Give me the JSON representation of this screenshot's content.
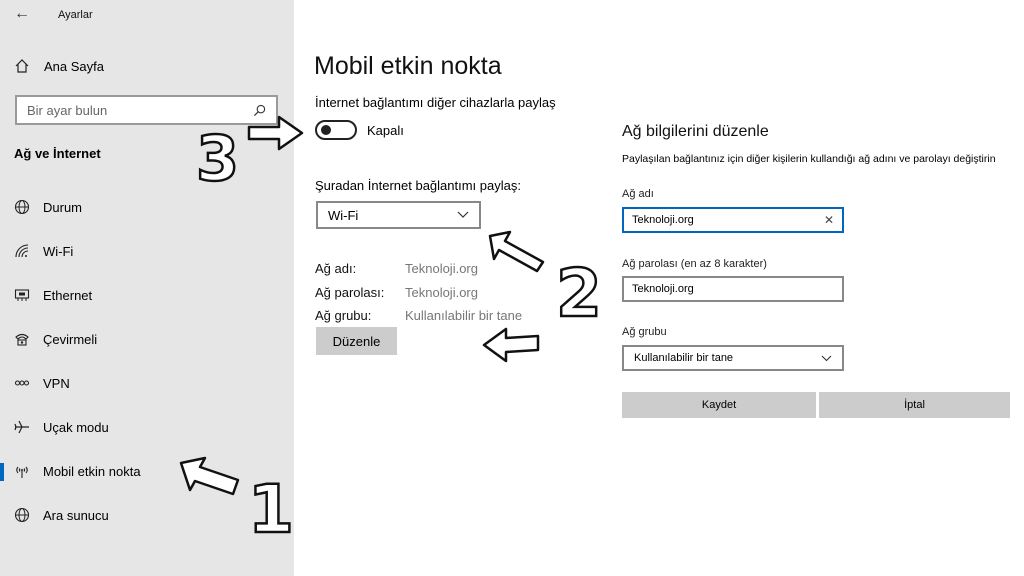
{
  "titlebar": {
    "back_icon": "back-arrow-icon",
    "title": "Ayarlar"
  },
  "sidebar": {
    "home_label": "Ana Sayfa",
    "search_placeholder": "Bir ayar bulun",
    "section_title": "Ağ ve İnternet",
    "items": [
      {
        "label": "Durum",
        "icon": "globe-icon"
      },
      {
        "label": "Wi-Fi",
        "icon": "wifi-icon"
      },
      {
        "label": "Ethernet",
        "icon": "ethernet-icon"
      },
      {
        "label": "Çevirmeli",
        "icon": "dialup-icon"
      },
      {
        "label": "VPN",
        "icon": "vpn-icon"
      },
      {
        "label": "Uçak modu",
        "icon": "airplane-icon"
      },
      {
        "label": "Mobil etkin nokta",
        "icon": "hotspot-icon",
        "active": true
      },
      {
        "label": "Ara sunucu",
        "icon": "globe-icon"
      }
    ]
  },
  "main": {
    "title": "Mobil etkin nokta",
    "share_label": "İnternet bağlantımı diğer cihazlarla paylaş",
    "toggle_state": "Kapalı",
    "from_label": "Şuradan İnternet bağlantımı paylaş:",
    "from_value": "Wi-Fi",
    "info": [
      {
        "key": "Ağ adı:",
        "value": "Teknoloji.org"
      },
      {
        "key": "Ağ parolası:",
        "value": "Teknoloji.org"
      },
      {
        "key": "Ağ grubu:",
        "value": "Kullanılabilir bir tane"
      }
    ],
    "edit_button": "Düzenle"
  },
  "panel": {
    "title": "Ağ bilgilerini düzenle",
    "description": "Paylaşılan bağlantınız için diğer kişilerin kullandığı ağ adını ve parolayı değiştirin",
    "name_label": "Ağ adı",
    "name_value": "Teknoloji.org",
    "password_label": "Ağ parolası (en az 8 karakter)",
    "password_value": "Teknoloji.org",
    "group_label": "Ağ grubu",
    "group_value": "Kullanılabilir bir tane",
    "save_button": "Kaydet",
    "cancel_button": "İptal"
  },
  "annotations": [
    "1",
    "2",
    "3"
  ],
  "colors": {
    "sidebar_bg": "#e6e6e6",
    "accent": "#0067c0",
    "button_bg": "#cccccc"
  }
}
